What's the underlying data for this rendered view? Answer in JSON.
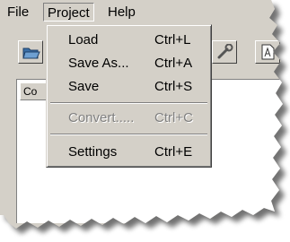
{
  "menubar": {
    "items": [
      {
        "label": "File"
      },
      {
        "label": "Project"
      },
      {
        "label": "Help"
      }
    ]
  },
  "project_menu": {
    "items": [
      {
        "label": "Load",
        "shortcut": "Ctrl+L",
        "enabled": true
      },
      {
        "label": "Save As...",
        "shortcut": "Ctrl+A",
        "enabled": true
      },
      {
        "label": "Save",
        "shortcut": "Ctrl+S",
        "enabled": true
      },
      {
        "label": "Convert.....",
        "shortcut": "Ctrl+C",
        "enabled": false
      },
      {
        "label": "Settings",
        "shortcut": "Ctrl+E",
        "enabled": true
      }
    ]
  },
  "toolbar": {
    "icons": [
      "open-folder-icon",
      "wrench-icon",
      "document-icon"
    ]
  },
  "panel": {
    "column_header": "Co"
  },
  "colors": {
    "face": "#d4d0c8",
    "highlight": "#ffffff",
    "shadow": "#808080",
    "dark_shadow": "#404040",
    "disabled_text": "#808080",
    "folder_blue": "#3a6ea5"
  }
}
